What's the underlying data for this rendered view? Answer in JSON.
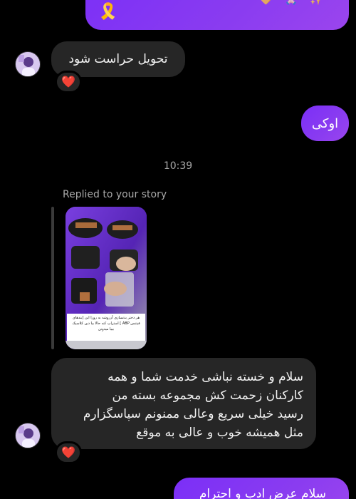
{
  "messages": {
    "top_outgoing_partial": "✨ 🙏🏻 💛",
    "top_outgoing_emoji": "🎗️",
    "incoming_1": "تحویل حراست شود",
    "incoming_1_reaction": "❤️",
    "outgoing_2": "اوکی",
    "timestamp": "10:39",
    "reply_label": "Replied to your story",
    "story_caption": "هر دختر بدنسازی آرزوشه به روزا این [بندهای فیتنس ABP ] استراپ کنه حالا بیا دین کلاسیک بییا میدونن",
    "incoming_2_lines": [
      "سلام و خسته نباشی خدمت شما و همه",
      "کارکنان زحمت کش مجموعه بسته من",
      "رسید خیلی سریع وعالی ممنونم سپاسگزارم",
      "مثل همیشه خوب و عالی به موقع"
    ],
    "incoming_2_reaction": "❤️",
    "bottom_outgoing_partial": "سلام عرض ادب و احترام"
  },
  "colors": {
    "outgoing_bubble": "#8a3cf0",
    "incoming_bubble": "#262626",
    "background": "#000000",
    "muted_text": "#a8a8a8"
  },
  "icons": {
    "avatar": "avatar-photo",
    "heart": "heart-icon"
  }
}
